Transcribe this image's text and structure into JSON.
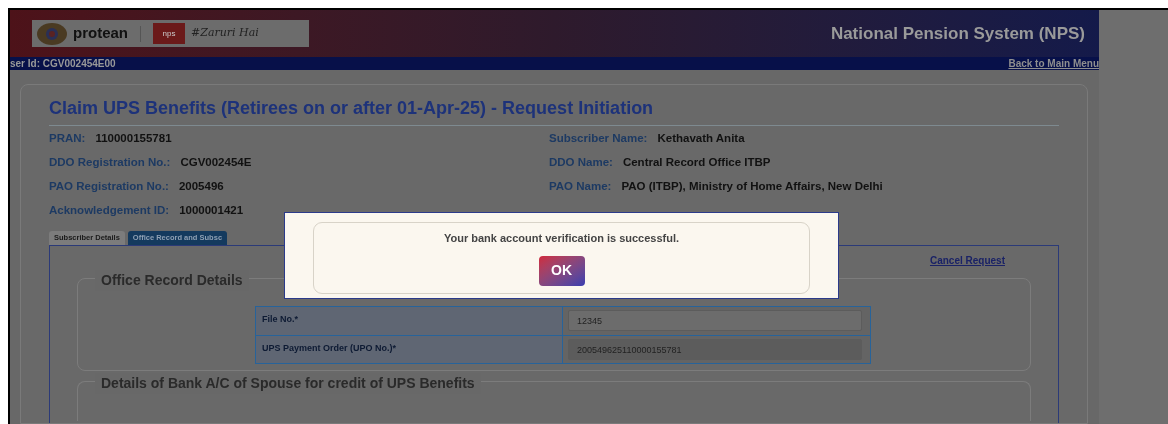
{
  "header": {
    "logo_text": "protean",
    "nps_badge": "nps",
    "tagline": "#Zaruri Hai",
    "title": "National Pension System (NPS)"
  },
  "user_bar": {
    "user_id": "ser Id: CGV002454E00",
    "back_link": "Back to Main Menu"
  },
  "page_title": "Claim UPS Benefits (Retirees on or after 01-Apr-25) - Request Initiation",
  "details": [
    {
      "label": "PRAN:",
      "value": "110000155781"
    },
    {
      "label": "Subscriber Name:",
      "value": "Kethavath Anita"
    },
    {
      "label": "DDO Registration No.:",
      "value": "CGV002454E"
    },
    {
      "label": "DDO Name:",
      "value": "Central Record Office ITBP"
    },
    {
      "label": "PAO Registration No.:",
      "value": "2005496"
    },
    {
      "label": "PAO Name:",
      "value": "PAO (ITBP), Ministry of Home Affairs, New Delhi"
    },
    {
      "label": "Acknowledgement ID:",
      "value": "1000001421"
    }
  ],
  "tabs": [
    {
      "label": "Subscriber Details",
      "selected": false
    },
    {
      "label": "Office Record and Subsc",
      "selected": true
    }
  ],
  "cancel_link": "Cancel Request",
  "sections": [
    {
      "legend": "Office Record Details",
      "fields": [
        {
          "label": "File No.*",
          "value": "12345",
          "disabled": false
        },
        {
          "label": "UPS Payment Order (UPO No.)*",
          "value": "200549625110000155781",
          "disabled": true
        }
      ]
    },
    {
      "legend": "Details of Bank A/C of Spouse for credit of UPS Benefits"
    }
  ],
  "dialog": {
    "message": "Your bank account verification is successful.",
    "button": "OK"
  }
}
